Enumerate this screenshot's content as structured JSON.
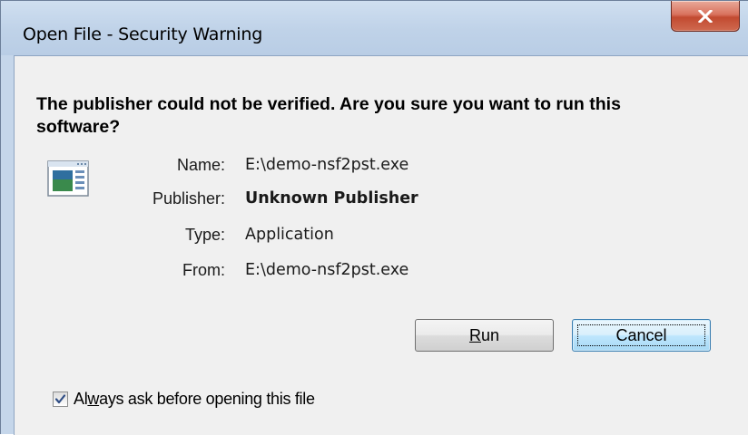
{
  "window": {
    "title": "Open File - Security Warning",
    "close_icon": "close-icon"
  },
  "message": {
    "heading": "The publisher could not be verified.  Are you sure you want to run this software?"
  },
  "file_info": {
    "icon": "application-icon",
    "name_label": "Name:",
    "name_value": "E:\\demo-nsf2pst.exe",
    "publisher_label": "Publisher:",
    "publisher_value": "Unknown Publisher",
    "type_label": "Type:",
    "type_value": "Application",
    "from_label": "From:",
    "from_value": "E:\\demo-nsf2pst.exe"
  },
  "buttons": {
    "run_prefix": "",
    "run_mnemonic": "R",
    "run_rest": "un",
    "cancel_label": "Cancel"
  },
  "checkbox": {
    "checked": true,
    "label_prefix": "Al",
    "label_mnemonic": "w",
    "label_rest": "ays ask before opening this file"
  },
  "colors": {
    "titlebar": "#c5d6ea",
    "close_button": "#c24a30",
    "dialog_body": "#f0f0f0",
    "default_button": "#bee6fd"
  }
}
